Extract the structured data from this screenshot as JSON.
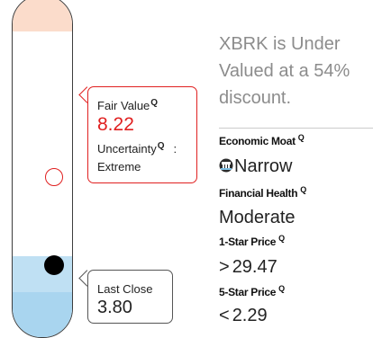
{
  "gauge": {
    "fair_value_position": 0.54,
    "last_close_position": 0.78,
    "colors": {
      "overvalued_zone": "#fbdccb",
      "undervalued_zone": "#bfe0f3",
      "fair_value_marker": "#e02020",
      "last_close_marker": "#000000"
    }
  },
  "fair_value_callout": {
    "label": "Fair Value",
    "info_icon": "Q",
    "value": "8.22",
    "uncertainty_label": "Uncertainty",
    "uncertainty_info_icon": "Q",
    "uncertainty_colon": ":",
    "uncertainty_value": "Extreme"
  },
  "last_close_callout": {
    "label": "Last Close",
    "value": "3.80"
  },
  "summary": {
    "headline": "XBRK is Under Valued at a 54% discount."
  },
  "metrics": {
    "economic_moat": {
      "label": "Economic Moat",
      "info_icon": "Q",
      "icon": "moat-icon",
      "value": "Narrow"
    },
    "financial_health": {
      "label": "Financial Health",
      "info_icon": "Q",
      "value": "Moderate"
    },
    "one_star_price": {
      "label": "1-Star Price",
      "info_icon": "Q",
      "comparator": ">",
      "value": "29.47"
    },
    "five_star_price": {
      "label": "5-Star Price",
      "info_icon": "Q",
      "comparator": "<",
      "value": "2.29"
    }
  }
}
